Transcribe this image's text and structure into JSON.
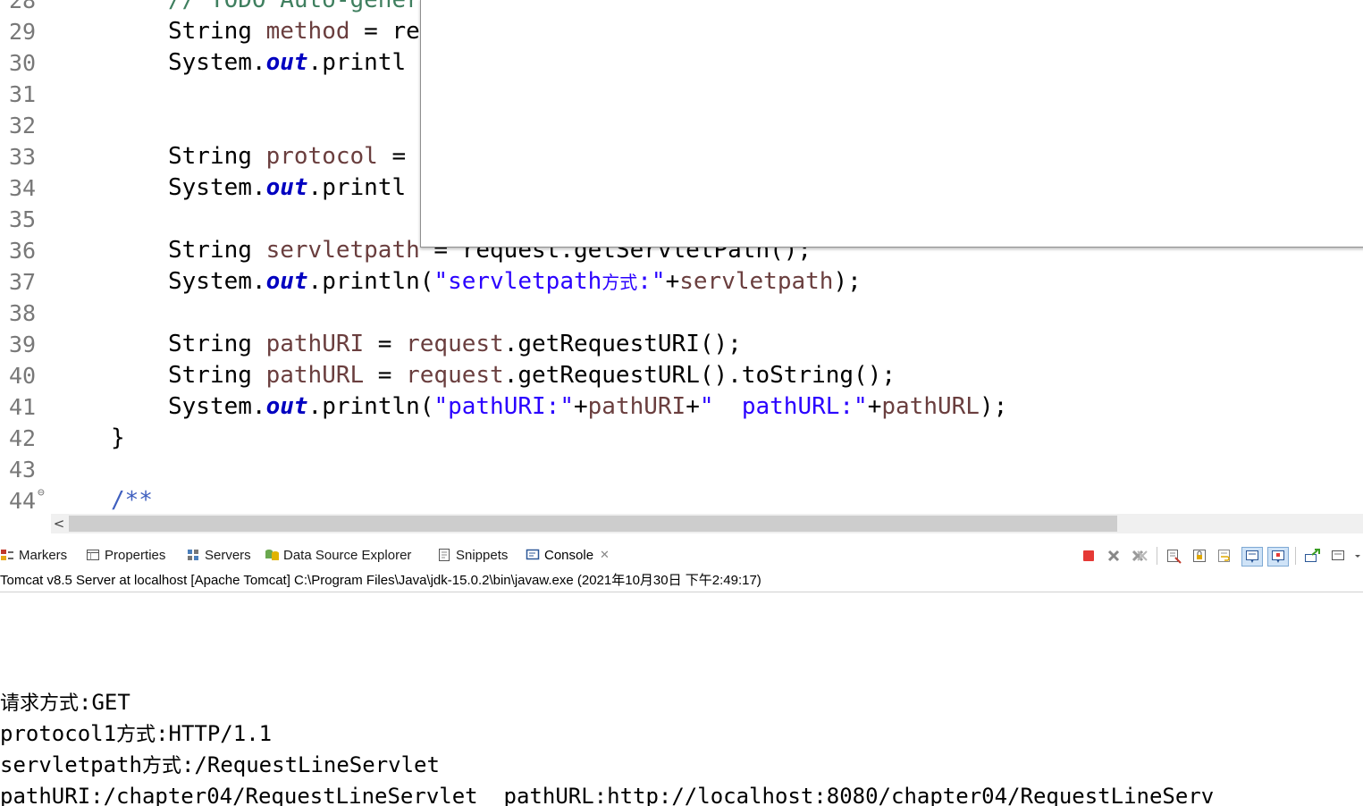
{
  "editor": {
    "lines": [
      {
        "n": "28",
        "segments": [
          {
            "t": "// TODO Auto-gener",
            "c": "cmt2"
          }
        ],
        "indent": "ind2"
      },
      {
        "n": "29",
        "segments": [
          {
            "t": "String ",
            "c": "kw"
          },
          {
            "t": "method",
            "c": "var"
          },
          {
            "t": " = re",
            "c": "kw"
          }
        ],
        "indent": "ind2"
      },
      {
        "n": "30",
        "segments": [
          {
            "t": "System.",
            "c": "kw"
          },
          {
            "t": "out",
            "c": "fld"
          },
          {
            "t": ".printl",
            "c": "kw"
          }
        ],
        "indent": "ind2"
      },
      {
        "n": "31",
        "segments": [],
        "indent": "ind2"
      },
      {
        "n": "32",
        "segments": [],
        "indent": "ind2"
      },
      {
        "n": "33",
        "segments": [
          {
            "t": "String ",
            "c": "kw"
          },
          {
            "t": "protocol",
            "c": "var"
          },
          {
            "t": " =",
            "c": "kw"
          }
        ],
        "indent": "ind2"
      },
      {
        "n": "34",
        "segments": [
          {
            "t": "System.",
            "c": "kw"
          },
          {
            "t": "out",
            "c": "fld"
          },
          {
            "t": ".printl",
            "c": "kw"
          }
        ],
        "indent": "ind2"
      },
      {
        "n": "35",
        "segments": [],
        "indent": "ind2"
      },
      {
        "n": "36",
        "segments": [
          {
            "t": "String ",
            "c": "kw"
          },
          {
            "t": "servletpath",
            "c": "var"
          },
          {
            "t": " = request.getServletPath();",
            "c": "kw"
          }
        ],
        "indent": "ind2"
      },
      {
        "n": "37",
        "segments": [
          {
            "t": "System.",
            "c": "kw"
          },
          {
            "t": "out",
            "c": "fld"
          },
          {
            "t": ".println(",
            "c": "kw"
          },
          {
            "t": "\"servletpath",
            "c": "str"
          },
          {
            "t": "方式",
            "c": "str cn"
          },
          {
            "t": ":\"",
            "c": "str"
          },
          {
            "t": "+",
            "c": "kw"
          },
          {
            "t": "servletpath",
            "c": "var"
          },
          {
            "t": ");",
            "c": "kw"
          }
        ],
        "indent": "ind2"
      },
      {
        "n": "38",
        "segments": [],
        "indent": "ind2"
      },
      {
        "n": "39",
        "segments": [
          {
            "t": "String ",
            "c": "kw"
          },
          {
            "t": "pathURI",
            "c": "var"
          },
          {
            "t": " = ",
            "c": "kw"
          },
          {
            "t": "request",
            "c": "var"
          },
          {
            "t": ".getRequestURI();",
            "c": "kw"
          }
        ],
        "indent": "ind2"
      },
      {
        "n": "40",
        "segments": [
          {
            "t": "String ",
            "c": "kw"
          },
          {
            "t": "pathURL",
            "c": "var"
          },
          {
            "t": " = ",
            "c": "kw"
          },
          {
            "t": "request",
            "c": "var"
          },
          {
            "t": ".getRequestURL().toString();",
            "c": "kw"
          }
        ],
        "indent": "ind2"
      },
      {
        "n": "41",
        "segments": [
          {
            "t": "System.",
            "c": "kw"
          },
          {
            "t": "out",
            "c": "fld"
          },
          {
            "t": ".println(",
            "c": "kw"
          },
          {
            "t": "\"pathURI:\"",
            "c": "str"
          },
          {
            "t": "+",
            "c": "kw"
          },
          {
            "t": "pathURI",
            "c": "var"
          },
          {
            "t": "+",
            "c": "kw"
          },
          {
            "t": "\"  pathURL:\"",
            "c": "str"
          },
          {
            "t": "+",
            "c": "kw"
          },
          {
            "t": "pathURL",
            "c": "var"
          },
          {
            "t": ");",
            "c": "kw"
          }
        ],
        "indent": "ind2"
      },
      {
        "n": "42",
        "segments": [
          {
            "t": "}",
            "c": "kw"
          }
        ],
        "indent": "ind1"
      },
      {
        "n": "43",
        "segments": [],
        "indent": "ind1"
      },
      {
        "n": "44",
        "segments": [
          {
            "t": "/**",
            "c": "cmt"
          }
        ],
        "indent": "ind1",
        "fold": "⊖"
      }
    ]
  },
  "scrollbar": {
    "left_arrow": "<"
  },
  "views": {
    "tabs": [
      {
        "label": "Markers",
        "icon": "markers-icon"
      },
      {
        "label": "Properties",
        "icon": "properties-icon"
      },
      {
        "label": "Servers",
        "icon": "servers-icon"
      },
      {
        "label": "Data Source Explorer",
        "icon": "data-source-explorer-icon"
      },
      {
        "label": "Snippets",
        "icon": "snippets-icon"
      },
      {
        "label": "Console",
        "icon": "console-icon",
        "active": true
      }
    ],
    "close_glyph": "✕"
  },
  "console": {
    "launch_info": "Tomcat v8.5 Server at localhost [Apache Tomcat] C:\\Program Files\\Java\\jdk-15.0.2\\bin\\javaw.exe  (2021年10月30日 下午2:49:17)",
    "output": [
      {
        "a": "",
        "cn": "请求方式",
        "b": ":GET"
      },
      {
        "a": "protocol1",
        "cn": "方式",
        "b": ":HTTP/1.1"
      },
      {
        "a": "servletpath",
        "cn": "方式",
        "b": ":/RequestLineServlet"
      },
      {
        "a": "pathURI:/chapter04/RequestLineServlet  pathURL:http://localhost:8080/chapter04/RequestLineServ",
        "cn": "",
        "b": ""
      }
    ]
  },
  "colors": {
    "stop": "#e53935",
    "accent": "#4a7ebb"
  }
}
